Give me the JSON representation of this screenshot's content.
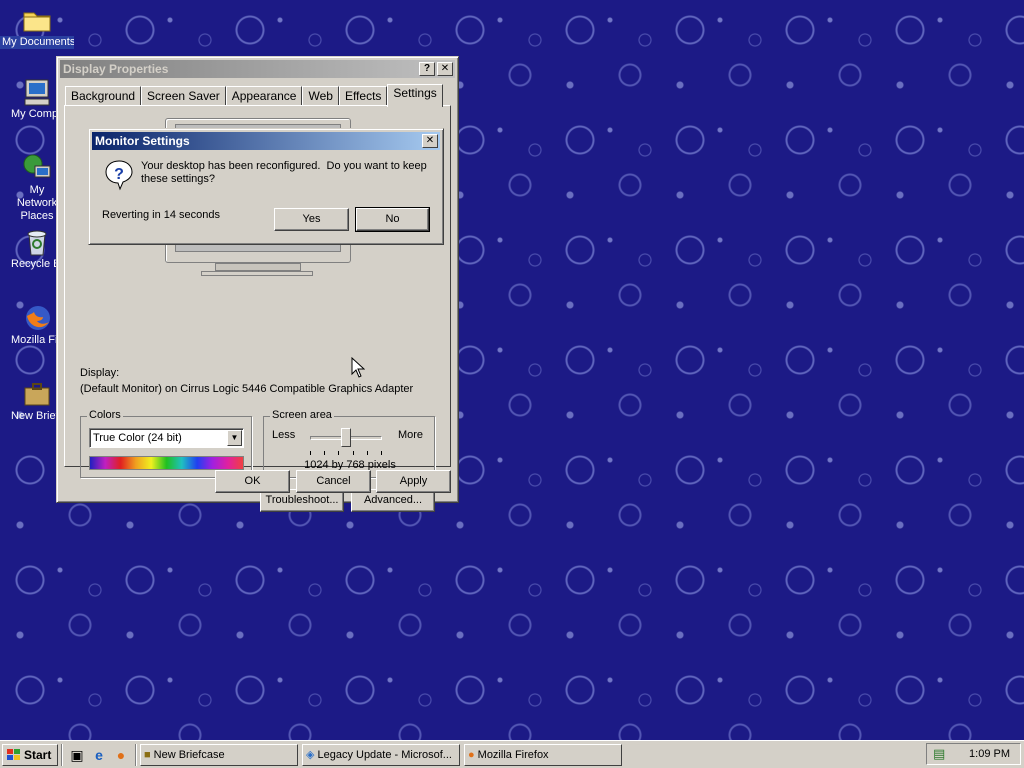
{
  "desktop": {
    "icons": [
      {
        "label": "My Documents",
        "icon": "folder-icon"
      },
      {
        "label": "My Computer",
        "icon": "computer-icon"
      },
      {
        "label": "My Network Places",
        "icon": "network-icon"
      },
      {
        "label": "Recycle Bin",
        "icon": "recycle-bin-icon"
      },
      {
        "label": "Mozilla Firefox",
        "icon": "firefox-icon"
      },
      {
        "label": "New Briefcase",
        "icon": "briefcase-icon"
      }
    ]
  },
  "display_properties": {
    "title": "Display Properties",
    "help_button": "?",
    "close_button": "✕",
    "tabs": [
      "Background",
      "Screen Saver",
      "Appearance",
      "Web",
      "Effects",
      "Settings"
    ],
    "active_tab": "Settings",
    "display_label": "Display:",
    "display_value": "(Default Monitor) on Cirrus Logic 5446 Compatible Graphics Adapter",
    "colors": {
      "group_label": "Colors",
      "selected": "True Color (24 bit)"
    },
    "screen_area": {
      "group_label": "Screen area",
      "less_label": "Less",
      "more_label": "More",
      "value_text": "1024 by 768 pixels",
      "slider_fraction": 0.5
    },
    "troubleshoot_button": "Troubleshoot...",
    "advanced_button": "Advanced...",
    "ok_button": "OK",
    "cancel_button": "Cancel",
    "apply_button": "Apply"
  },
  "monitor_settings": {
    "title": "Monitor Settings",
    "close_button": "✕",
    "message": "Your desktop has been reconfigured.  Do you want to keep these settings?",
    "countdown": "Reverting in 14 seconds",
    "yes_button": "Yes",
    "no_button": "No"
  },
  "taskbar": {
    "start_label": "Start",
    "quick_launch": [
      "show-desktop-icon",
      "internet-explorer-icon",
      "firefox-icon"
    ],
    "tasks": [
      {
        "label": "New Briefcase",
        "icon": "briefcase-icon"
      },
      {
        "label": "Legacy Update - Microsof...",
        "icon": "legacy-update-icon"
      },
      {
        "label": "Mozilla Firefox",
        "icon": "firefox-icon"
      }
    ],
    "clock": "1:09 PM"
  },
  "colors": {
    "desktop_bg": "#1c1a86",
    "title_active": "#0a246a",
    "title_inactive": "#808080",
    "face": "#d4d0c8"
  }
}
